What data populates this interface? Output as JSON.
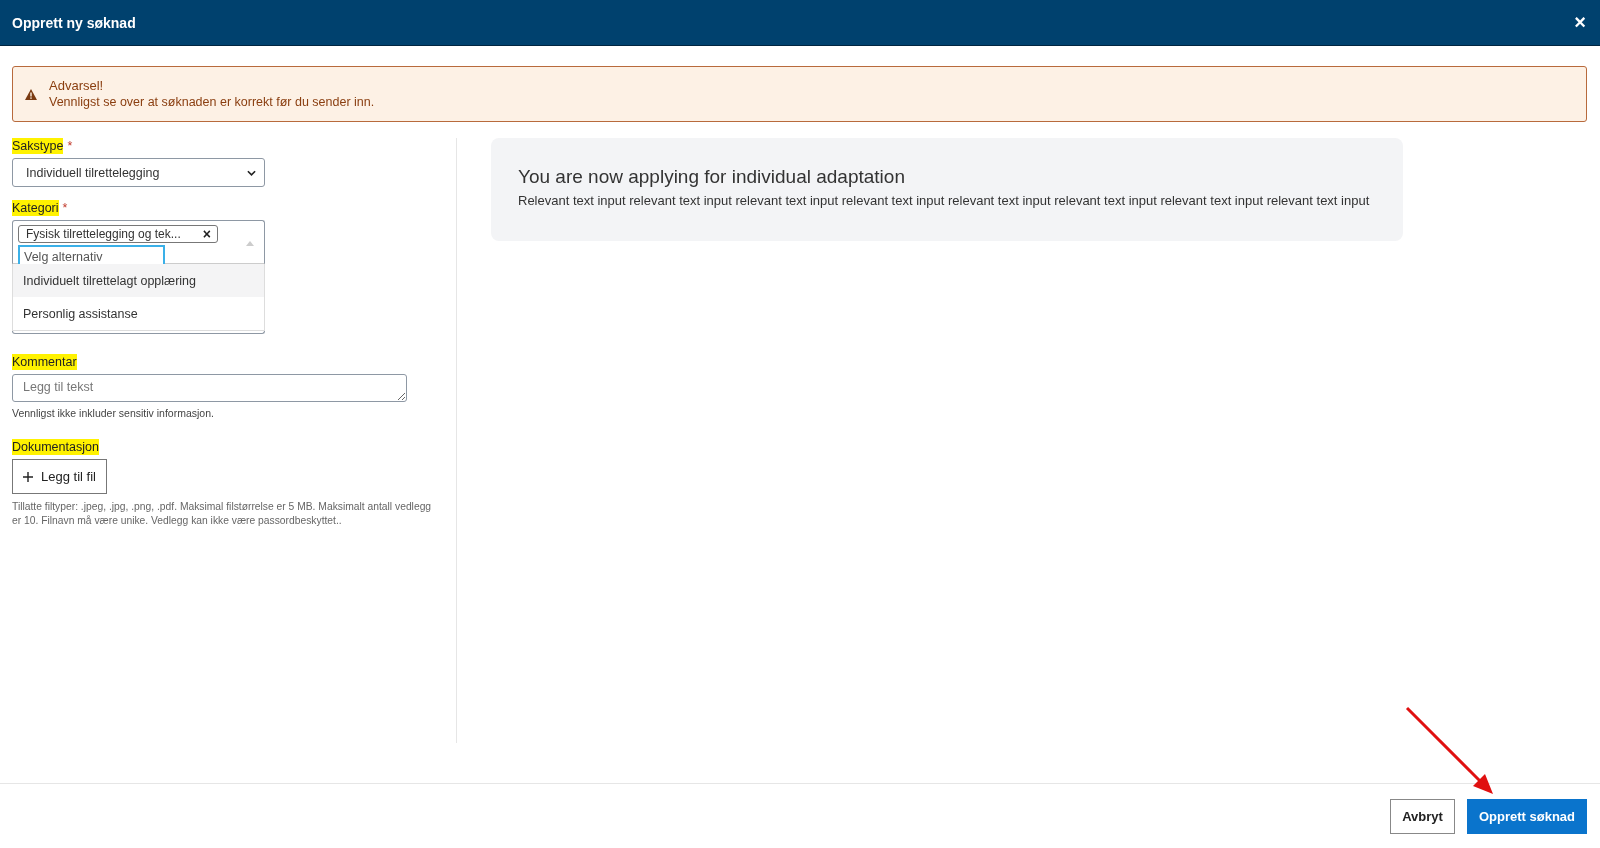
{
  "window": {
    "title": "Opprett ny søknad",
    "close": "×"
  },
  "alert": {
    "title": "Advarsel!",
    "message": "Vennligst se over at søknaden er korrekt før du sender inn."
  },
  "form": {
    "sakstype": {
      "label": "Sakstype",
      "required": "*",
      "highlighted": true,
      "value": "Individuell tilrettelegging"
    },
    "kategori": {
      "label": "Kategori",
      "required": "*",
      "highlighted": true,
      "tags": [
        {
          "label": "Fysisk tilrettelegging og tek...",
          "remove": "×"
        }
      ],
      "placeholder": "Velg alternativ",
      "expanded": true,
      "options": [
        {
          "label": "Individuelt tilrettelagt opplæring",
          "selected": true
        },
        {
          "label": "Personlig assistanse",
          "selected": false
        }
      ]
    },
    "kommentar": {
      "label": "Kommentar",
      "highlighted": true,
      "placeholder": "Legg til tekst",
      "hint": "Vennligst ikke inkluder sensitiv informasjon."
    },
    "dokumentasjon": {
      "label": "Dokumentasjon",
      "highlighted": true,
      "button": "Legg til fil",
      "hint": "Tillatte filtyper: .jpeg, .jpg, .png, .pdf. Maksimal filstørrelse er 5 MB. Maksimalt antall vedlegg er 10. Filnavn må være unike. Vedlegg kan ikke være passordbeskyttet.."
    }
  },
  "info_panel": {
    "title": "You are now applying for individual adaptation",
    "text": "Relevant text input relevant text input relevant text input relevant text input relevant text input relevant text input relevant text input relevant text input"
  },
  "buttons": [
    {
      "label": "Avbryt",
      "kind": "secondary"
    },
    {
      "label": "Opprett søknad",
      "kind": "primary"
    }
  ],
  "annotation": {
    "kind": "arrow"
  }
}
